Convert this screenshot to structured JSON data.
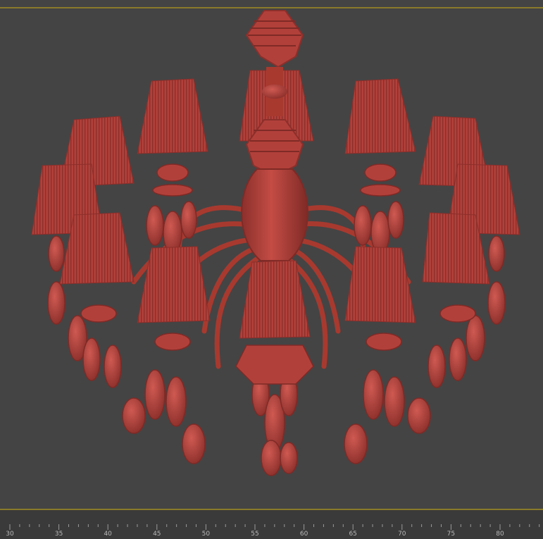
{
  "viewport": {
    "background": "#444444",
    "frame_color": "#8a7a2a",
    "model_color": "#b2403a",
    "model_shade": "#8c2f2b",
    "model_highlight": "#cf5a52"
  },
  "timeline": {
    "tick_labels": [
      "30",
      "35",
      "40",
      "45",
      "50",
      "55",
      "60",
      "65",
      "70",
      "75",
      "80"
    ]
  }
}
